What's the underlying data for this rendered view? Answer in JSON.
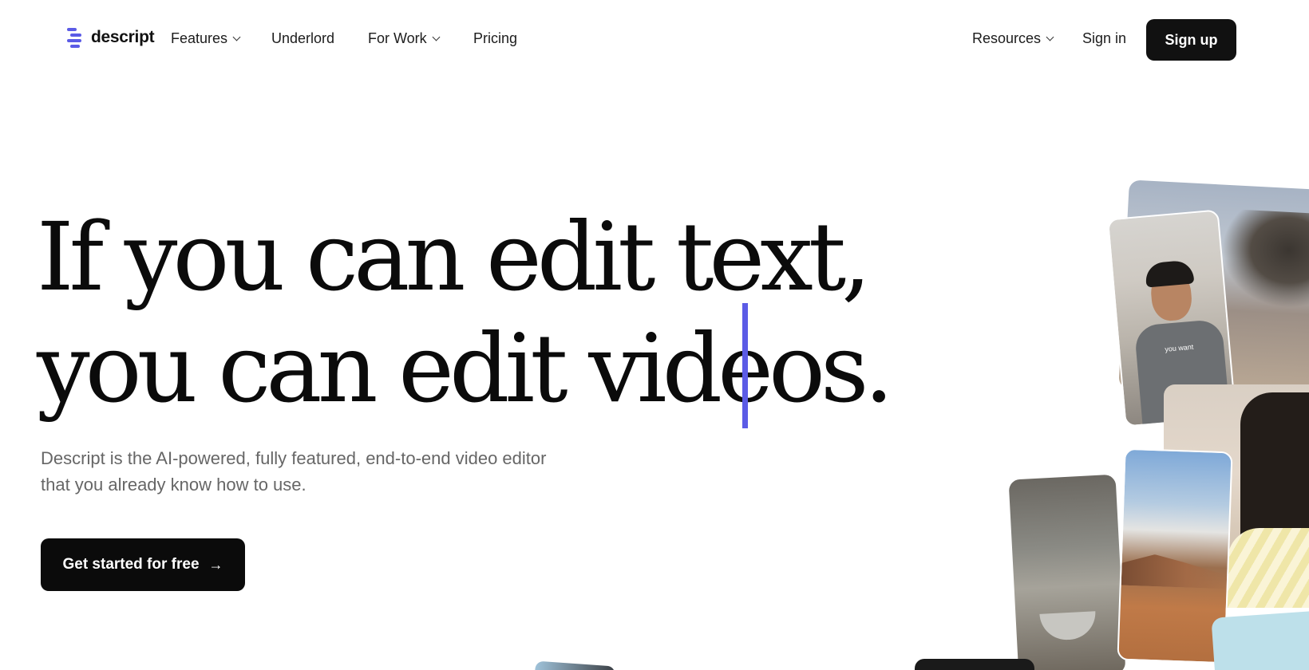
{
  "nav": {
    "logo_text": "descript",
    "items": [
      {
        "label": "Features",
        "has_dropdown": true
      },
      {
        "label": "Underlord",
        "has_dropdown": false
      },
      {
        "label": "For Work",
        "has_dropdown": true
      },
      {
        "label": "Pricing",
        "has_dropdown": false
      }
    ],
    "resources": {
      "label": "Resources",
      "has_dropdown": true
    },
    "sign_in": "Sign in",
    "sign_up": "Sign up"
  },
  "hero": {
    "headline_line1": "If you can edit text,",
    "headline_line2": "you can edit videos.",
    "subtitle_line1": "Descript is the AI-powered, fully featured, end-to-end video editor",
    "subtitle_line2": "that you already know how to use.",
    "cta_label": "Get started for free",
    "cta_icon": "arrow-right-icon"
  },
  "collage": {
    "man_video_caption": "you want"
  },
  "colors": {
    "accent": "#5b5be6",
    "button_bg": "#111111",
    "text": "#0b0b0b",
    "subtle_text": "#666666"
  }
}
